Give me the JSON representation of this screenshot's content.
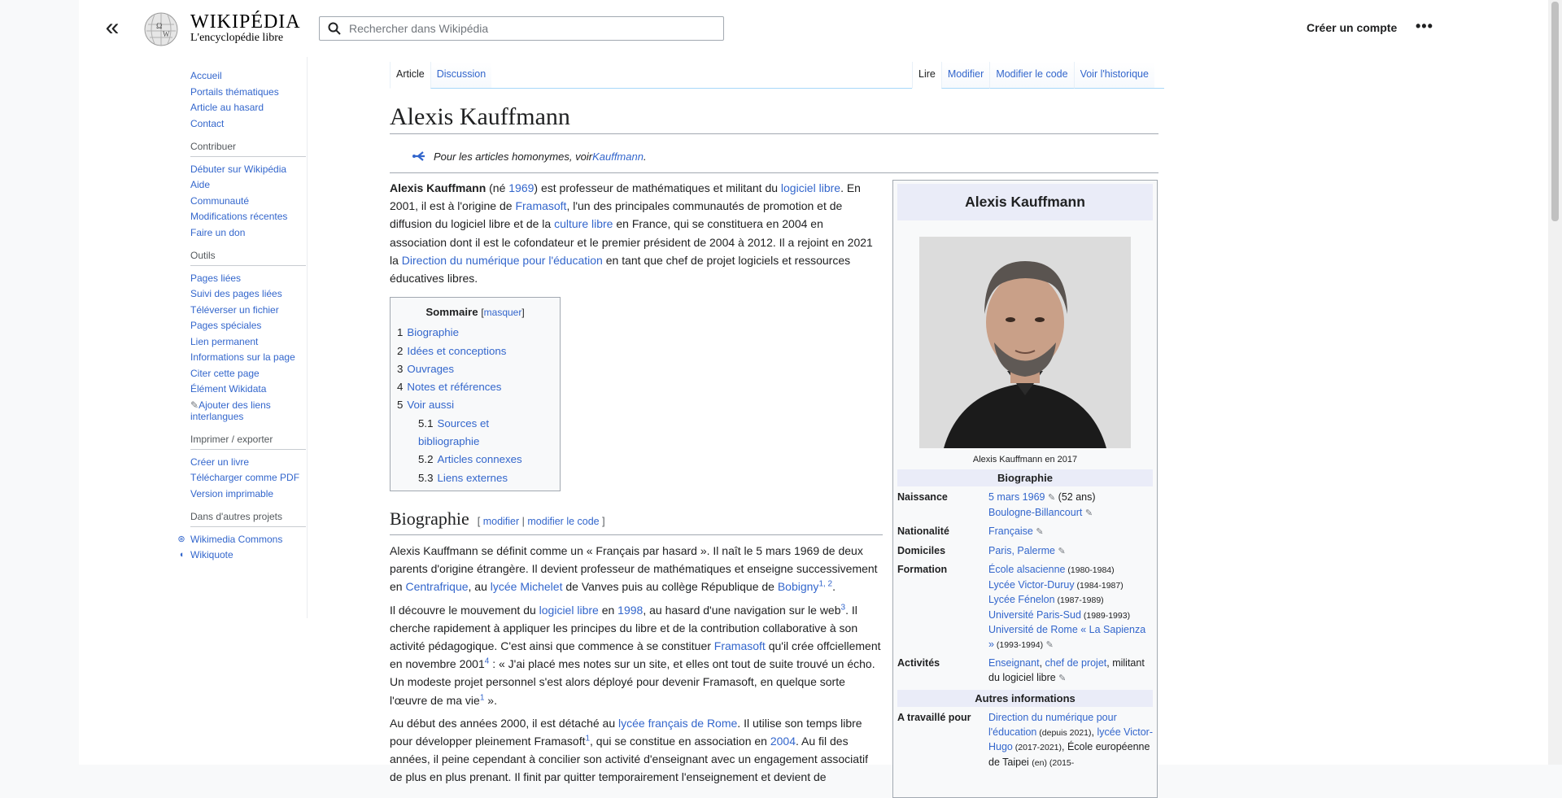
{
  "colors": {
    "link": "#3366cc",
    "text": "#202122",
    "tab_border": "#a7d7f9"
  },
  "header": {
    "wordmark_title": "WIKIPÉDIA",
    "wordmark_tagline": "L'encyclopédie libre",
    "search_placeholder": "Rechercher dans Wikipédia",
    "create_account": "Créer un compte",
    "more_menu": "•••"
  },
  "sidebar": {
    "main": [
      "Accueil",
      "Portails thématiques",
      "Article au hasard",
      "Contact"
    ],
    "contribuer_heading": "Contribuer",
    "contribuer": [
      "Débuter sur Wikipédia",
      "Aide",
      "Communauté",
      "Modifications récentes",
      "Faire un don"
    ],
    "outils_heading": "Outils",
    "outils": [
      "Pages liées",
      "Suivi des pages liées",
      "Téléverser un fichier",
      "Pages spéciales",
      "Lien permanent",
      "Informations sur la page",
      "Citer cette page",
      "Élément Wikidata",
      "Ajouter des liens interlangues"
    ],
    "export_heading": "Imprimer / exporter",
    "export": [
      "Créer un livre",
      "Télécharger comme PDF",
      "Version imprimable"
    ],
    "projets_heading": "Dans d'autres projets",
    "projets": [
      "Wikimedia Commons",
      "Wikiquote"
    ]
  },
  "tabs": {
    "left": [
      "Article",
      "Discussion"
    ],
    "right": [
      "Lire",
      "Modifier",
      "Modifier le code",
      "Voir l'historique"
    ]
  },
  "article": {
    "title": "Alexis Kauffmann",
    "hatnote_prefix": "Pour les articles homonymes, voir ",
    "hatnote_link": "Kauffmann",
    "hatnote_suffix": ".",
    "intro": {
      "t1": "Alexis Kauffmann",
      "t2": " (né ",
      "l1": "1969",
      "t3": ") est professeur de mathématiques et militant du ",
      "l2": "logiciel libre",
      "t4": ". En 2001, il est à l'origine de ",
      "l3": "Framasoft",
      "t5": ", l'un des principales communautés de promotion et de diffusion du logiciel libre et de la ",
      "l4": "culture libre",
      "t6": " en France, qui se constituera en 2004 en association dont il est le cofondateur et le premier président de 2004 à 2012. Il a rejoint en 2021 la ",
      "l5": "Direction du numérique pour l'éducation",
      "t7": " en tant que chef de projet logiciels et ressources éducatives libres."
    },
    "toc": {
      "title": "Sommaire",
      "hide": "masquer",
      "items": [
        {
          "num": "1",
          "label": "Biographie"
        },
        {
          "num": "2",
          "label": "Idées et conceptions"
        },
        {
          "num": "3",
          "label": "Ouvrages"
        },
        {
          "num": "4",
          "label": "Notes et références"
        },
        {
          "num": "5",
          "label": "Voir aussi"
        },
        {
          "num": "5.1",
          "label": "Sources et bibliographie"
        },
        {
          "num": "5.2",
          "label": "Articles connexes"
        },
        {
          "num": "5.3",
          "label": "Liens externes"
        }
      ]
    },
    "bio_heading": "Biographie",
    "edit_links": {
      "open": "[ ",
      "modifier": "modifier",
      "sep": " | ",
      "modifier_code": "modifier le code",
      "close": " ]"
    },
    "p1": {
      "t1": "Alexis Kauffmann se définit comme un « Français par hasard ». Il naît le 5 mars 1969 de deux parents d'origine étrangère. Il devient professeur de mathématiques et enseigne successivement en ",
      "l1": "Centrafrique",
      "t2": ", au ",
      "l2": "lycée Michelet",
      "t3": " de Vanves puis au collège République de ",
      "l3": "Bobigny",
      "s1": "1, 2",
      "t4": "."
    },
    "p2": {
      "t1": "Il découvre le mouvement du ",
      "l1": "logiciel libre",
      "t2": " en ",
      "l2": "1998",
      "t3": ", au hasard d'une navigation sur le web",
      "s1": "3",
      "t4": ". Il cherche rapidement à appliquer les principes du libre et de la contribution collaborative à son activité pédagogique. C'est ainsi que commence à se constituer ",
      "l3": "Framasoft",
      "t5": " qu'il crée offciellement en novembre 2001",
      "s2": "4",
      "t6": " : « J'ai placé mes notes sur un site, et elles ont tout de suite trouvé un écho. Un modeste projet personnel s'est alors déployé pour devenir Framasoft, en quelque sorte l'œuvre de ma vie",
      "s3": "1",
      "t7": " »."
    },
    "p3": {
      "t1": "Au début des années 2000, il est détaché au ",
      "l1": "lycée français de Rome",
      "t2": ". Il utilise son temps libre pour développer pleinement Framasoft",
      "s1": "1",
      "t3": ", qui se constitue en association en ",
      "l2": "2004",
      "t4": ". Au fil des années, il peine cependant à concilier son activité d'enseignant avec un engagement associatif de plus en plus prenant. Il finit par quitter temporairement l'enseignement et devient de"
    }
  },
  "infobox": {
    "title": "Alexis Kauffmann",
    "caption": "Alexis Kauffmann en 2017",
    "section_bio": "Biographie",
    "naissance_label": "Naissance",
    "naissance_date": "5 mars 1969",
    "naissance_age": " (52 ans)",
    "naissance_lieu": "Boulogne-Billancourt",
    "nationalite_label": "Nationalité",
    "nationalite": "Française",
    "domiciles_label": "Domiciles",
    "domiciles": "Paris, Palerme",
    "formation_label": "Formation",
    "formation": [
      {
        "name": "École alsacienne",
        "years": " (1980-1984)"
      },
      {
        "name": "Lycée Victor-Duruy",
        "years": " (1984-1987)"
      },
      {
        "name": "Lycée Fénelon",
        "years": " (1987-1989)"
      },
      {
        "name": "Université Paris-Sud",
        "years": " (1989-1993)"
      },
      {
        "name": "Université de Rome « La Sapienza »",
        "years": " (1993-1994)"
      }
    ],
    "activites_label": "Activités",
    "activites_l1": "Enseignant",
    "activites_sep": ", ",
    "activites_l2": "chef de projet",
    "activites_t": ", militant du logiciel libre",
    "section_autres": "Autres informations",
    "travaille_label": "A travaillé pour",
    "travaille_l1": "Direction du numérique pour l'éducation",
    "travaille_y1": " (depuis 2021)",
    "travaille_sep": ", ",
    "travaille_l2": "lycée Victor-Hugo",
    "travaille_y2": " (2017-2021)",
    "travaille_t": ", École européenne de Taipei ",
    "travaille_en": "(en)",
    "travaille_y3": " (2015-"
  }
}
